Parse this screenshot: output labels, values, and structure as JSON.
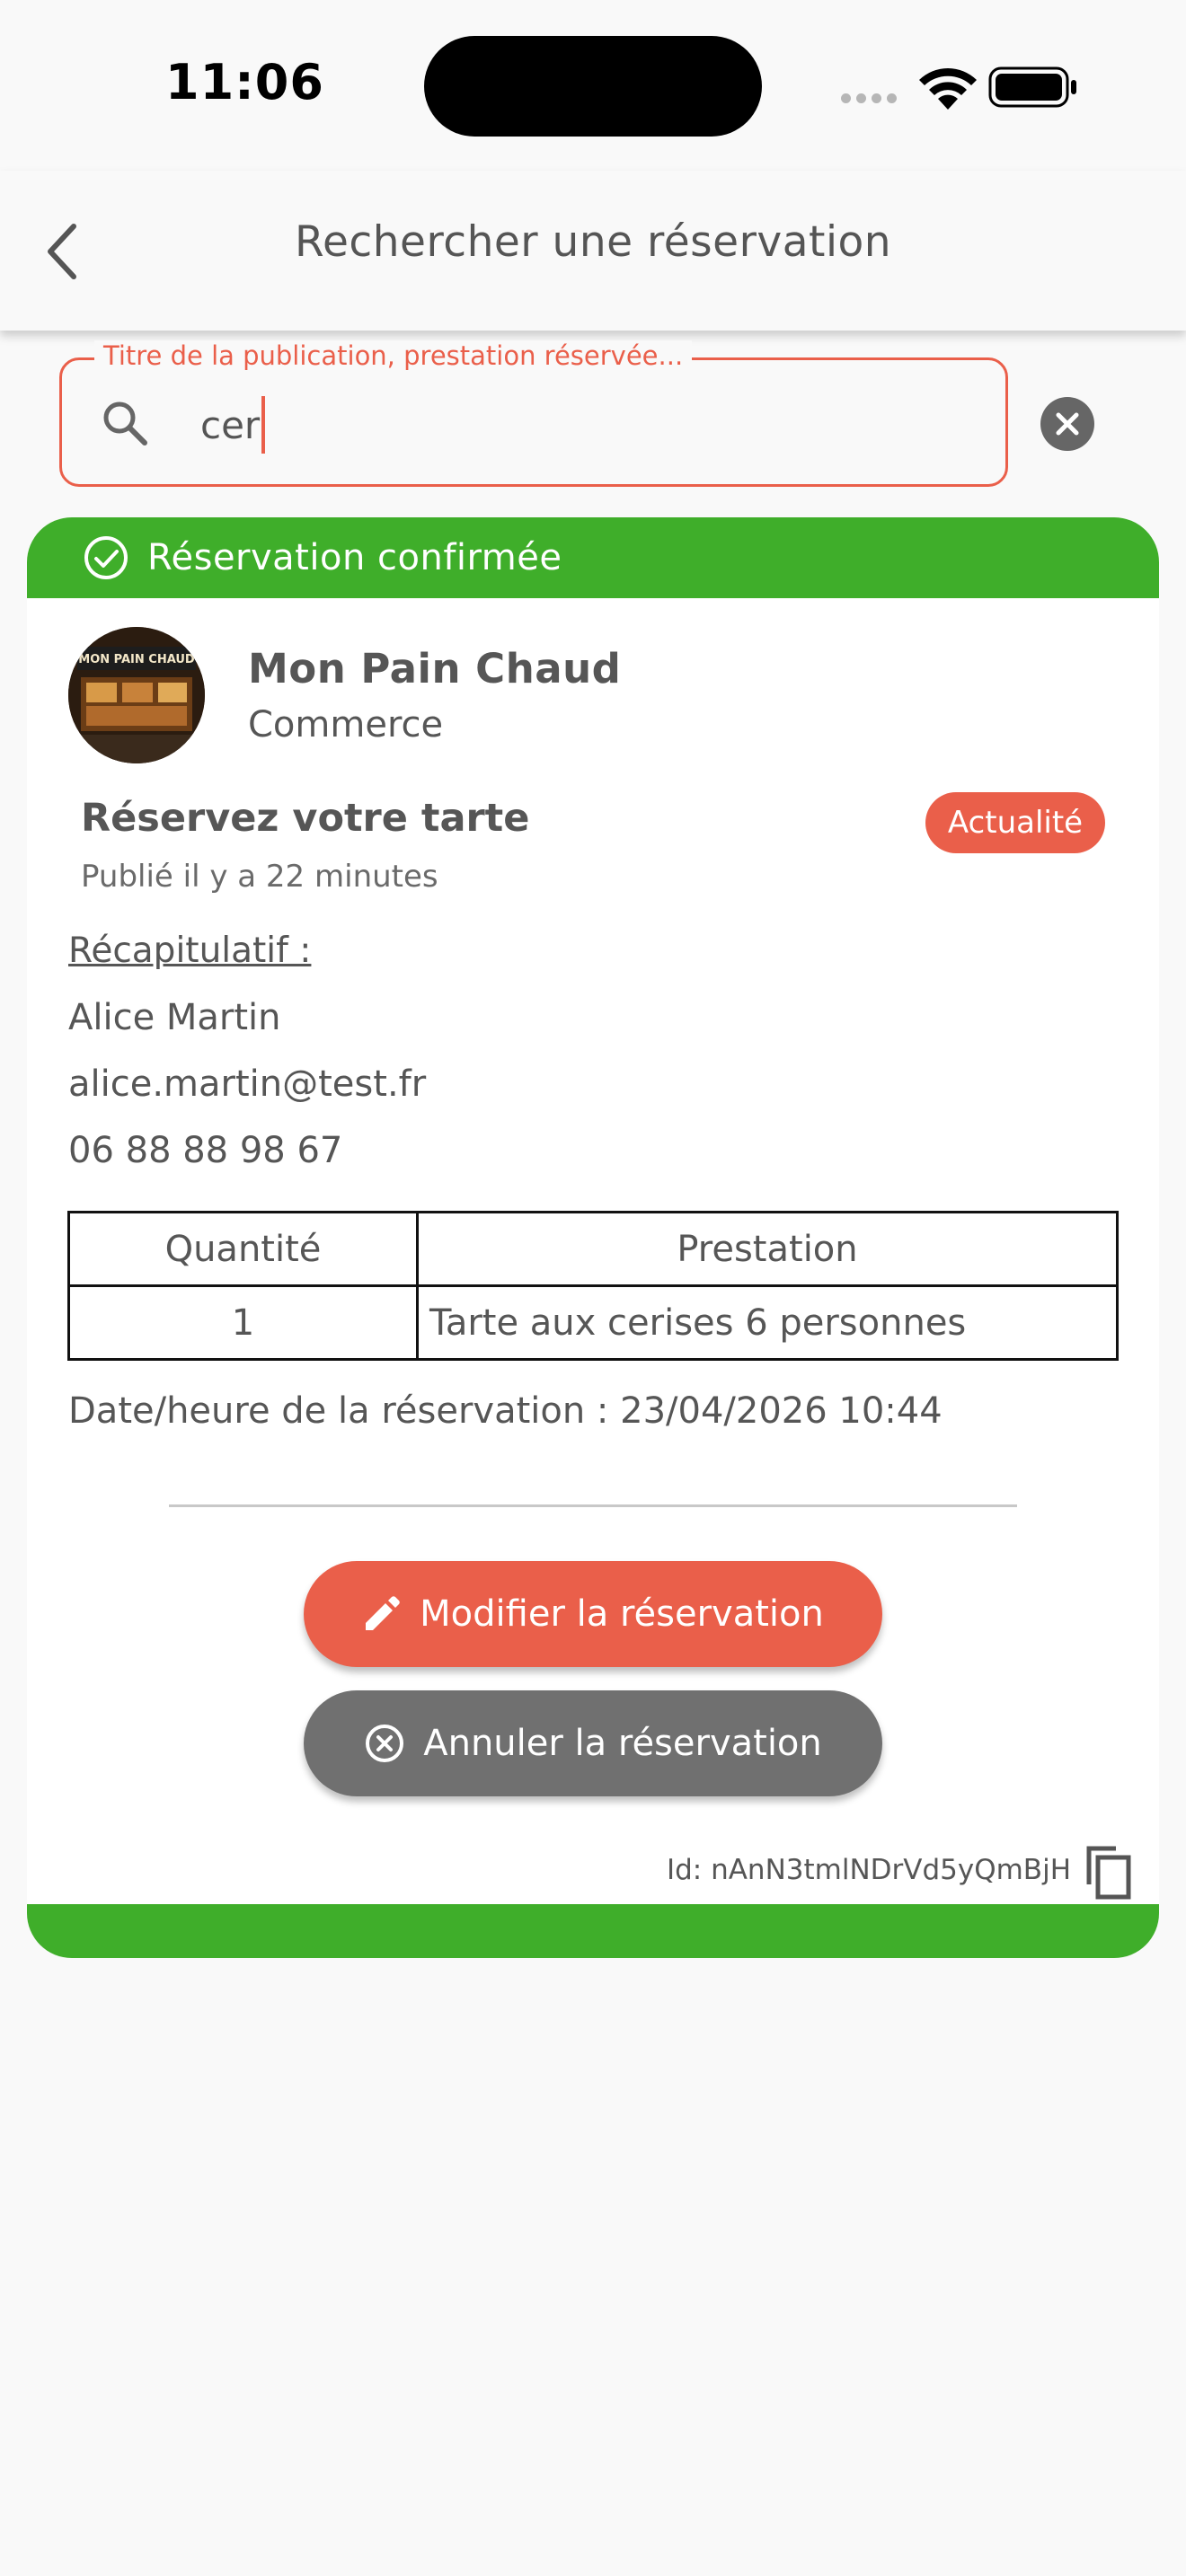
{
  "status_bar": {
    "time": "11:06"
  },
  "header": {
    "title": "Rechercher une réservation"
  },
  "search": {
    "label": "Titre de la publication, prestation réservée...",
    "value": "cer"
  },
  "reservation": {
    "status": "Réservation confirmée",
    "merchant_name": "Mon Pain Chaud",
    "merchant_category": "Commerce",
    "avatar_sign_text": "MON PAIN CHAUD",
    "publication_title": "Réservez votre tarte",
    "badge": "Actualité",
    "published": "Publié il y a 22 minutes",
    "recap_title": "Récapitulatif :",
    "customer_name": "Alice Martin",
    "customer_email": "alice.martin@test.fr",
    "customer_phone": "06 88 88 98 67",
    "table": {
      "headers": [
        "Quantité",
        "Prestation"
      ],
      "rows": [
        {
          "qty": "1",
          "prestation": "Tarte aux cerises 6 personnes"
        }
      ]
    },
    "date_line": "Date/heure de la réservation : 23/04/2026 10:44",
    "edit_button": "Modifier la réservation",
    "cancel_button": "Annuler la réservation",
    "id": "Id: nAnN3tmlNDrVd5yQmBjH"
  },
  "colors": {
    "accent": "#ea5f4a",
    "confirmed": "#3fae2a",
    "cancel": "#707070",
    "text": "#565656"
  },
  "icons": [
    "back-chevron-icon",
    "search-icon",
    "clear-icon",
    "check-circle-icon",
    "pencil-icon",
    "cancel-circle-icon",
    "copy-icon"
  ]
}
